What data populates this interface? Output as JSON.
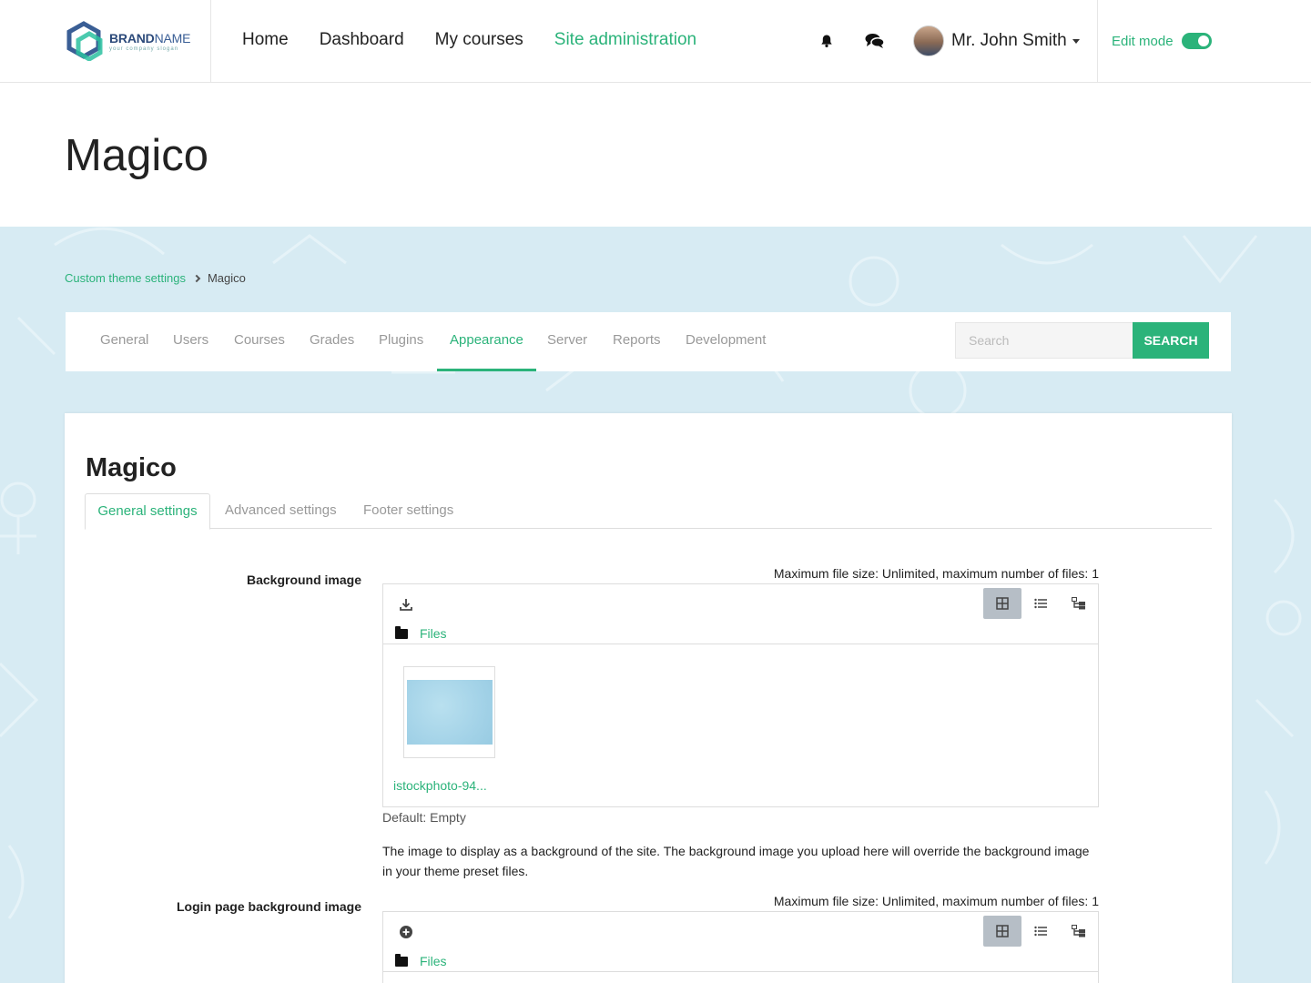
{
  "brand": {
    "name_bold": "BRAND",
    "name_light": "NAME",
    "slogan": "your company slogan"
  },
  "nav": {
    "links": [
      "Home",
      "Dashboard",
      "My courses",
      "Site administration"
    ],
    "active": "Site administration"
  },
  "user": {
    "name": "Mr. John Smith"
  },
  "edit_mode": {
    "label": "Edit mode",
    "enabled": true
  },
  "page": {
    "title": "Magico"
  },
  "breadcrumb": {
    "parent": "Custom theme settings",
    "current": "Magico"
  },
  "admin_tabs": {
    "items": [
      "General",
      "Users",
      "Courses",
      "Grades",
      "Plugins",
      "Appearance",
      "Server",
      "Reports",
      "Development"
    ],
    "active": "Appearance"
  },
  "search": {
    "placeholder": "Search",
    "button": "SEARCH"
  },
  "card": {
    "title": "Magico",
    "tabs": [
      "General settings",
      "Advanced settings",
      "Footer settings"
    ],
    "active_tab": "General settings"
  },
  "settings": [
    {
      "label": "Background image",
      "max_info": "Maximum file size: Unlimited, maximum number of files: 1",
      "path": "Files",
      "file_name": "istockphoto-94...",
      "default": "Default: Empty",
      "description": "The image to display as a background of the site. The background image you upload here will override the background image in your theme preset files."
    },
    {
      "label": "Login page background image",
      "max_info": "Maximum file size: Unlimited, maximum number of files: 1",
      "path": "Files"
    }
  ],
  "colors": {
    "accent": "#2bb37a",
    "pattern_bg": "#d7ebf3",
    "view_active": "#b6bec6"
  },
  "icons": [
    "bell-icon",
    "chat-icon",
    "caret-down-icon",
    "download-icon",
    "add-icon",
    "grid-view-icon",
    "list-view-icon",
    "tree-view-icon",
    "folder-icon",
    "chevron-right-icon"
  ]
}
